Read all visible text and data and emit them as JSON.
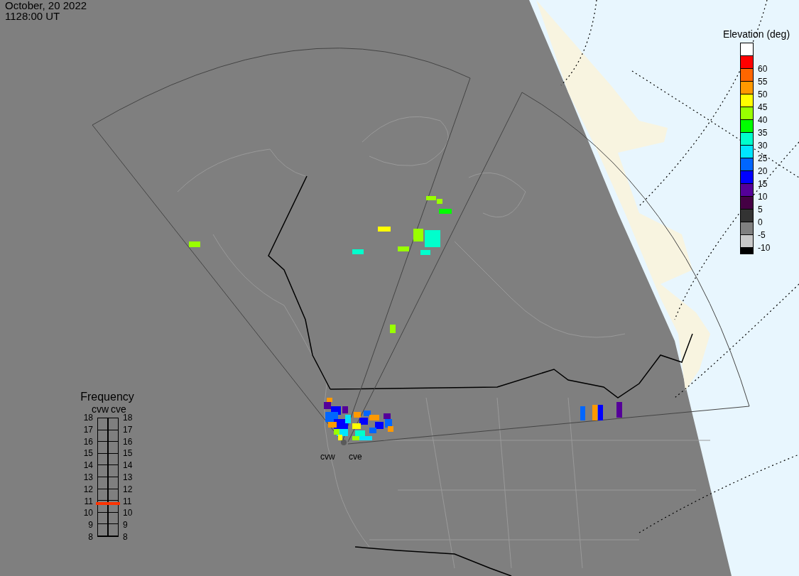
{
  "header": {
    "date": "October, 20 2022",
    "time": "1128:00 UT"
  },
  "legend": {
    "title": "Elevation (deg)",
    "swatches": [
      {
        "color": "#ffffff"
      },
      {
        "color": "#ff0000",
        "label": "60"
      },
      {
        "color": "#ff6600",
        "label": "55"
      },
      {
        "color": "#ff9900",
        "label": "50"
      },
      {
        "color": "#ffff00",
        "label": "45"
      },
      {
        "color": "#99ff00",
        "label": "40"
      },
      {
        "color": "#00ff00",
        "label": "35"
      },
      {
        "color": "#00ffcc",
        "label": "30"
      },
      {
        "color": "#00e5ff",
        "label": "25"
      },
      {
        "color": "#0066ff",
        "label": "20"
      },
      {
        "color": "#0000ff",
        "label": "15"
      },
      {
        "color": "#550099",
        "label": "10"
      },
      {
        "color": "#440044",
        "label": "5"
      },
      {
        "color": "#333333",
        "label": "0"
      },
      {
        "color": "#808080",
        "label": "-5"
      },
      {
        "color": "#c8c8c8",
        "label": "-10"
      }
    ]
  },
  "radar_labels": [
    "cvw",
    "cve"
  ],
  "frequency": {
    "title": "Frequency",
    "radars": [
      {
        "name": "cvw",
        "level": 0.28,
        "ticks": [
          "18",
          "17",
          "16",
          "15",
          "14",
          "13",
          "12",
          "11",
          "10",
          "9",
          "8"
        ]
      },
      {
        "name": "cve",
        "level": 0.28,
        "ticks": [
          "18",
          "17",
          "16",
          "15",
          "14",
          "13",
          "12",
          "11",
          "10",
          "9",
          "8"
        ]
      }
    ]
  }
}
